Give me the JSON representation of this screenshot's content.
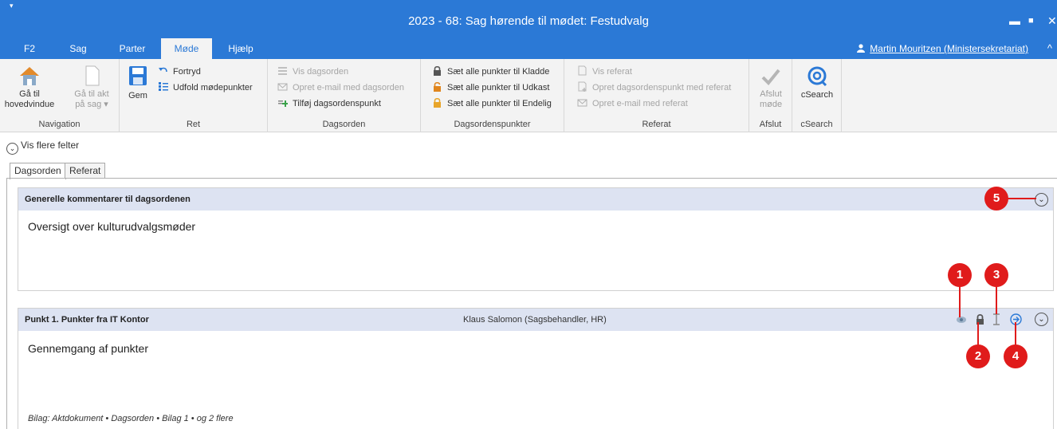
{
  "window": {
    "title": "2023 - 68: Sag hørende til mødet: Festudvalg",
    "quick_access": "▾",
    "minimize": "▬",
    "maximize": "■",
    "close": "✕"
  },
  "menu": {
    "tabs": [
      {
        "label": "F2"
      },
      {
        "label": "Sag"
      },
      {
        "label": "Parter"
      },
      {
        "label": "Møde"
      },
      {
        "label": "Hjælp"
      }
    ],
    "active_tab": "Møde",
    "user": "Martin Mouritzen (Ministersekretariat)",
    "collapse": "^"
  },
  "ribbon": {
    "navigation": {
      "label": "Navigation",
      "goto_main_line1": "Gå til",
      "goto_main_line2": "hovedvindue",
      "goto_doc_line1": "Gå til akt",
      "goto_doc_line2": "på sag ▾"
    },
    "ret": {
      "label": "Ret",
      "save": "Gem",
      "undo": "Fortryd",
      "expand_points": "Udfold mødepunkter"
    },
    "dagsorden": {
      "label": "Dagsorden",
      "show": "Vis dagsorden",
      "email": "Opret e-mail med dagsorden",
      "add_point": "Tilføj dagsordenspunkt"
    },
    "dagsordenspunkter": {
      "label": "Dagsordenspunkter",
      "draft": "Sæt alle punkter til Kladde",
      "proposal": "Sæt alle punkter til Udkast",
      "final": "Sæt alle punkter til Endelig"
    },
    "referat": {
      "label": "Referat",
      "show": "Vis referat",
      "create_point": "Opret dagsordenspunkt med referat",
      "email": "Opret e-mail med referat"
    },
    "afslut": {
      "label": "Afslut",
      "close_line1": "Afslut",
      "close_line2": "møde"
    },
    "csearch": {
      "label": "cSearch",
      "button": "cSearch"
    }
  },
  "fields_toggle": "Vis flere felter",
  "doc_tabs": [
    {
      "label": "Dagsorden"
    },
    {
      "label": "Referat"
    }
  ],
  "general_section": {
    "header": "Generelle kommentarer til dagsordenen",
    "body": "Oversigt over kulturudvalgsmøder"
  },
  "point1": {
    "header": "Punkt 1.  Punkter fra IT Kontor",
    "owner": "Klaus Salomon (Sagsbehandler, HR)",
    "body": "Gennemgang af punkter",
    "attachments": "Bilag: Aktdokument • Dagsorden • Bilag 1 •  og 2 flere"
  },
  "callouts": [
    "1",
    "2",
    "3",
    "4",
    "5"
  ],
  "icons": {
    "expand_glyph": "⌄",
    "eye": "eye-icon",
    "lock": "lock-icon",
    "text_cursor": "text-cursor-icon",
    "arrow": "arrow-right-icon"
  },
  "colors": {
    "accent": "#2b79d6",
    "callout": "#e01b1b",
    "section_header": "#dde3f2"
  }
}
